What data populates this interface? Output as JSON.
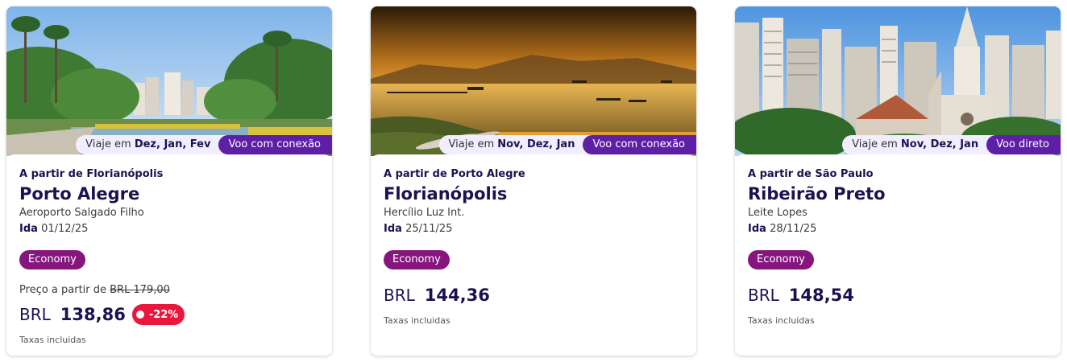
{
  "cards": [
    {
      "period_prefix": "Viaje em ",
      "period_months": "Dez, Jan, Fev",
      "connection": "Voo com conexão",
      "from": "A partir de Florianópolis",
      "city": "Porto Alegre",
      "airport": "Aeroporto Salgado Filho",
      "ida_label": "Ida",
      "ida_date": "01/12/25",
      "cabin": "Economy",
      "from_price_label": "Preço a partir de ",
      "old_price": "BRL  179,00",
      "currency": "BRL",
      "price": "138,86",
      "discount": "-22%",
      "taxes": "Taxas incluidas"
    },
    {
      "period_prefix": "Viaje em ",
      "period_months": "Nov, Dez, Jan",
      "connection": "Voo com conexão",
      "from": "A partir de Porto Alegre",
      "city": "Florianópolis",
      "airport": "Hercílio Luz Int.",
      "ida_label": "Ida",
      "ida_date": "25/11/25",
      "cabin": "Economy",
      "currency": "BRL",
      "price": "144,36",
      "taxes": "Taxas incluidas"
    },
    {
      "period_prefix": "Viaje em ",
      "period_months": "Nov, Dez, Jan",
      "connection": "Voo direto",
      "from": "A partir de São Paulo",
      "city": "Ribeirão Preto",
      "airport": "Leite Lopes",
      "ida_label": "Ida",
      "ida_date": "28/11/25",
      "cabin": "Economy",
      "currency": "BRL",
      "price": "148,54",
      "taxes": "Taxas incluidas"
    }
  ],
  "colors": {
    "brand_purple": "#5e1ea6",
    "economy_badge": "#86167e",
    "discount_red": "#e8173b",
    "text_dark": "#1d1150"
  },
  "icons": [
    "discount-tag-icon"
  ]
}
